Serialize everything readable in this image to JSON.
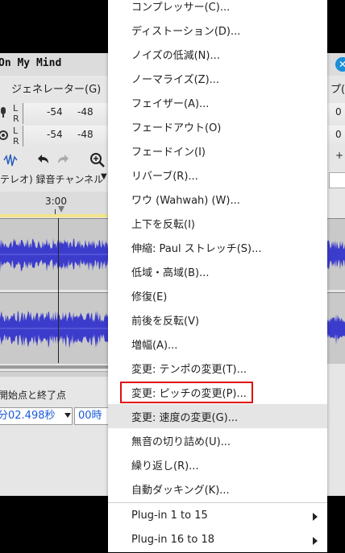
{
  "window": {
    "title": "On My Mind",
    "menu_left": "ジェネレーター(G)",
    "menu_right": "プ(H)"
  },
  "meters": {
    "record": {
      "l": "L",
      "r": "R",
      "v1": "-54",
      "v2": "-48",
      "right_value": "0"
    },
    "playback": {
      "l": "L",
      "r": "R",
      "v1": "-54",
      "v2": "-48",
      "right_value": "0"
    },
    "small_right": "+"
  },
  "device": {
    "channels": "テレオ) 録音チャンネル"
  },
  "timeline": {
    "label": "3:00"
  },
  "selection": {
    "label": "開始点と終了点",
    "start_time": "分02.498秒",
    "end_time": "00時"
  },
  "colors": {
    "waveform": "#3c3ccc",
    "highlight": "#e01010",
    "accent": "#1a8fd8"
  },
  "menu": {
    "items": [
      {
        "label": "コンプレッサー(C)..."
      },
      {
        "label": "ディストーション(D)..."
      },
      {
        "label": "ノイズの低減(N)..."
      },
      {
        "label": "ノーマライズ(Z)..."
      },
      {
        "label": "フェイザー(A)..."
      },
      {
        "label": "フェードアウト(O)"
      },
      {
        "label": "フェードイン(I)"
      },
      {
        "label": "リバーブ(R)..."
      },
      {
        "label": "ワウ (Wahwah) (W)..."
      },
      {
        "label": "上下を反転(I)"
      },
      {
        "label": "伸縮: Paul ストレッチ(S)..."
      },
      {
        "label": "低域・高域(B)..."
      },
      {
        "label": "修復(E)"
      },
      {
        "label": "前後を反転(V)"
      },
      {
        "label": "増幅(A)..."
      },
      {
        "label": "変更: テンポの変更(T)..."
      },
      {
        "label": "変更: ピッチの変更(P)..."
      },
      {
        "label": "変更: 速度の変更(G)..."
      },
      {
        "label": "無音の切り詰め(U)..."
      },
      {
        "label": "繰り返し(R)..."
      },
      {
        "label": "自動ダッキング(K)..."
      }
    ],
    "plugins": [
      {
        "label": "Plug-in 1 to 15"
      },
      {
        "label": "Plug-in 16 to 18"
      }
    ]
  }
}
